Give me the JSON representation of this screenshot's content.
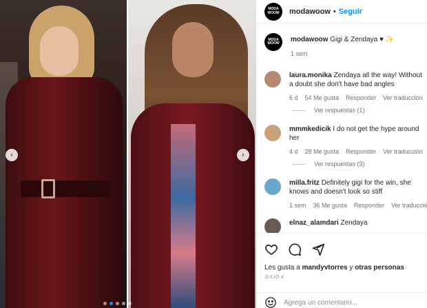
{
  "post": {
    "username": "modawoow",
    "separator": "•",
    "follow_label": "Seguir",
    "avatar_text": "MODA\nWOOW",
    "caption_text": "Gigi & Zendaya ♥",
    "caption_emoji": "✨",
    "caption_time": "1 sem"
  },
  "comments": [
    {
      "username": "laura.monika",
      "text": "Zendaya all the way! Without a doubt she don't have bad angles",
      "time": "6 d",
      "likes": "54 Me gusta",
      "reply": "Responder",
      "translate": "Ver traducción",
      "avatar_color": "#b48a6e",
      "view_replies": "Ver respuestas (1)"
    },
    {
      "username": "mmmkedicik",
      "text": "I do not get the hype around her",
      "time": "4 d",
      "likes": "28 Me gusta",
      "reply": "Responder",
      "translate": "Ver traducción",
      "avatar_color": "#c9a27a",
      "view_replies": "Ver respuestas (3)"
    },
    {
      "username": "milla.fritz",
      "text": "Definitely gigi for the win, she knows and doesn't look so stiff",
      "time": "1 sem",
      "likes": "36 Me gusta",
      "reply": "Responder",
      "translate": "Ver traducción",
      "avatar_color": "#6aa6c9"
    },
    {
      "username": "elnaz_alamdari",
      "text": "Zendaya",
      "avatar_color": "#6b5a50"
    }
  ],
  "actions": {
    "likes_prefix": "Les gusta a ",
    "likes_user": "mandyvtorres",
    "likes_suffix": " y ",
    "likes_others": "otras personas",
    "date": "JULIO 4"
  },
  "add_comment": {
    "placeholder": "Agrega un comentario..."
  },
  "carousel": {
    "prev_icon": "‹",
    "next_icon": "›",
    "dot_count": 5,
    "active_dot": 1
  },
  "colors": {
    "follow_blue": "#0095f6",
    "carousel_active_dot": "#1e8df0"
  }
}
